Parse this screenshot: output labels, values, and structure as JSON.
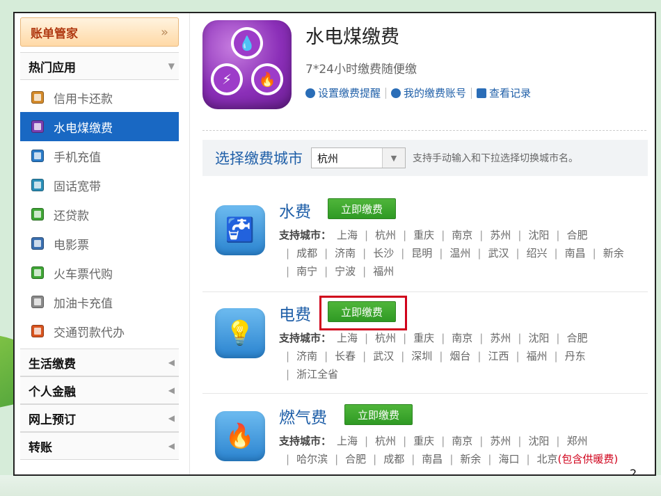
{
  "sidebar": {
    "account_title": "账单管家",
    "account_chevron": "»",
    "hot_group": "热门应用",
    "items": [
      {
        "label": "信用卡还款",
        "color": "#d48a2a"
      },
      {
        "label": "水电煤缴费",
        "color": "#7a3fb0",
        "active": true
      },
      {
        "label": "手机充值",
        "color": "#2b7bc7"
      },
      {
        "label": "固话宽带",
        "color": "#2a8fb8"
      },
      {
        "label": "还贷款",
        "color": "#3fa635"
      },
      {
        "label": "电影票",
        "color": "#3a6fb0"
      },
      {
        "label": "火车票代购",
        "color": "#3fa635"
      },
      {
        "label": "加油卡充值",
        "color": "#8a8a8a"
      },
      {
        "label": "交通罚款代办",
        "color": "#d9541e"
      }
    ],
    "groups": [
      "生活缴费",
      "个人金融",
      "网上预订",
      "转账"
    ]
  },
  "header": {
    "title": "水电煤缴费",
    "subtitle": "7*24小时缴费随便缴",
    "links": [
      "设置缴费提醒",
      "我的缴费账号",
      "查看记录"
    ]
  },
  "city": {
    "label": "选择缴费城市",
    "value": "杭州",
    "hint": "支持手动输入和下拉选择切换城市名。"
  },
  "services": [
    {
      "name": "水费",
      "pay": "立即缴费",
      "cities_label": "支持城市：",
      "cities": [
        "上海",
        "杭州",
        "重庆",
        "南京",
        "苏州",
        "沈阳",
        "合肥",
        "成都",
        "济南",
        "长沙",
        "昆明",
        "温州",
        "武汉",
        "绍兴",
        "南昌",
        "新余",
        "南宁",
        "宁波",
        "福州"
      ]
    },
    {
      "name": "电费",
      "pay": "立即缴费",
      "cities_label": "支持城市：",
      "cities": [
        "上海",
        "杭州",
        "重庆",
        "南京",
        "苏州",
        "沈阳",
        "合肥",
        "济南",
        "长春",
        "武汉",
        "深圳",
        "烟台",
        "江西",
        "福州",
        "丹东",
        "浙江全省"
      ]
    },
    {
      "name": "燃气费",
      "pay": "立即缴费",
      "cities_label": "支持城市：",
      "cities": [
        "上海",
        "杭州",
        "重庆",
        "南京",
        "苏州",
        "沈阳",
        "郑州",
        "哈尔滨",
        "合肥",
        "成都",
        "南昌",
        "新余",
        "海口",
        "北京"
      ],
      "note": "(包含供暖费)"
    }
  ],
  "page_number": "2"
}
